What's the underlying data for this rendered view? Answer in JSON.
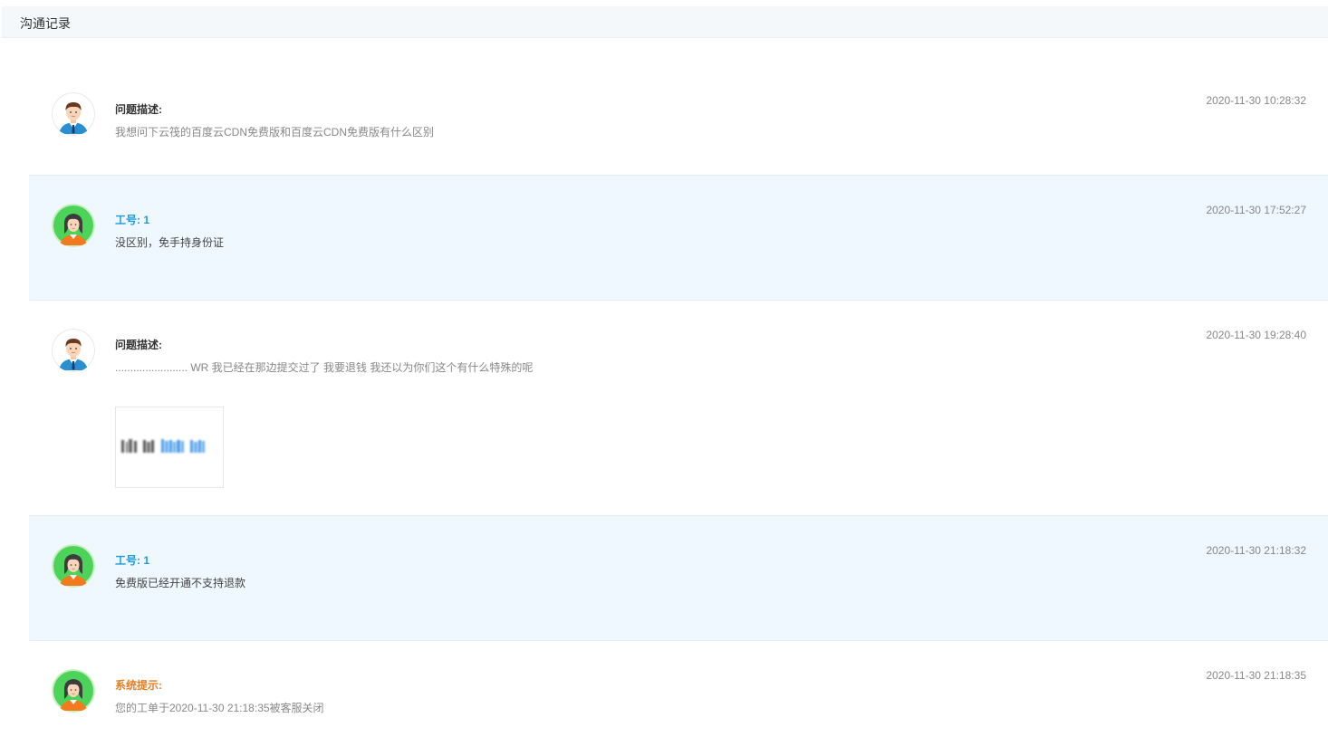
{
  "header": {
    "title": "沟通记录"
  },
  "records": [
    {
      "role": "user",
      "avatar_icon": "male-user-avatar-icon",
      "label": "问题描述:",
      "message": "我想问下云筏的百度云CDN免费版和百度云CDN免费版有什么区别",
      "timestamp": "2020-11-30 10:28:32"
    },
    {
      "role": "agent",
      "avatar_icon": "female-agent-avatar-icon",
      "label": "工号: 1",
      "message": "没区别，免手持身份证",
      "timestamp": "2020-11-30 17:52:27"
    },
    {
      "role": "user",
      "avatar_icon": "male-user-avatar-icon",
      "label": "问题描述:",
      "message": "........................ WR 我已经在那边提交过了 我要退钱 我还以为你们这个有什么特殊的呢",
      "timestamp": "2020-11-30 19:28:40",
      "attachment_icon": "image-attachment-thumbnail"
    },
    {
      "role": "agent",
      "avatar_icon": "female-agent-avatar-icon",
      "label": "工号: 1",
      "message": "免费版已经开通不支持退款",
      "timestamp": "2020-11-30 21:18:32"
    },
    {
      "role": "system",
      "avatar_icon": "female-agent-avatar-icon",
      "label": "系统提示:",
      "message": "您的工单于2020-11-30 21:18:35被客服关闭",
      "timestamp": "2020-11-30 21:18:35"
    }
  ],
  "colors": {
    "agent_label": "#1a9bdc",
    "system_label": "#e67e22",
    "agent_row_bg": "#eef8fe",
    "header_bg": "#f5f8fa"
  }
}
